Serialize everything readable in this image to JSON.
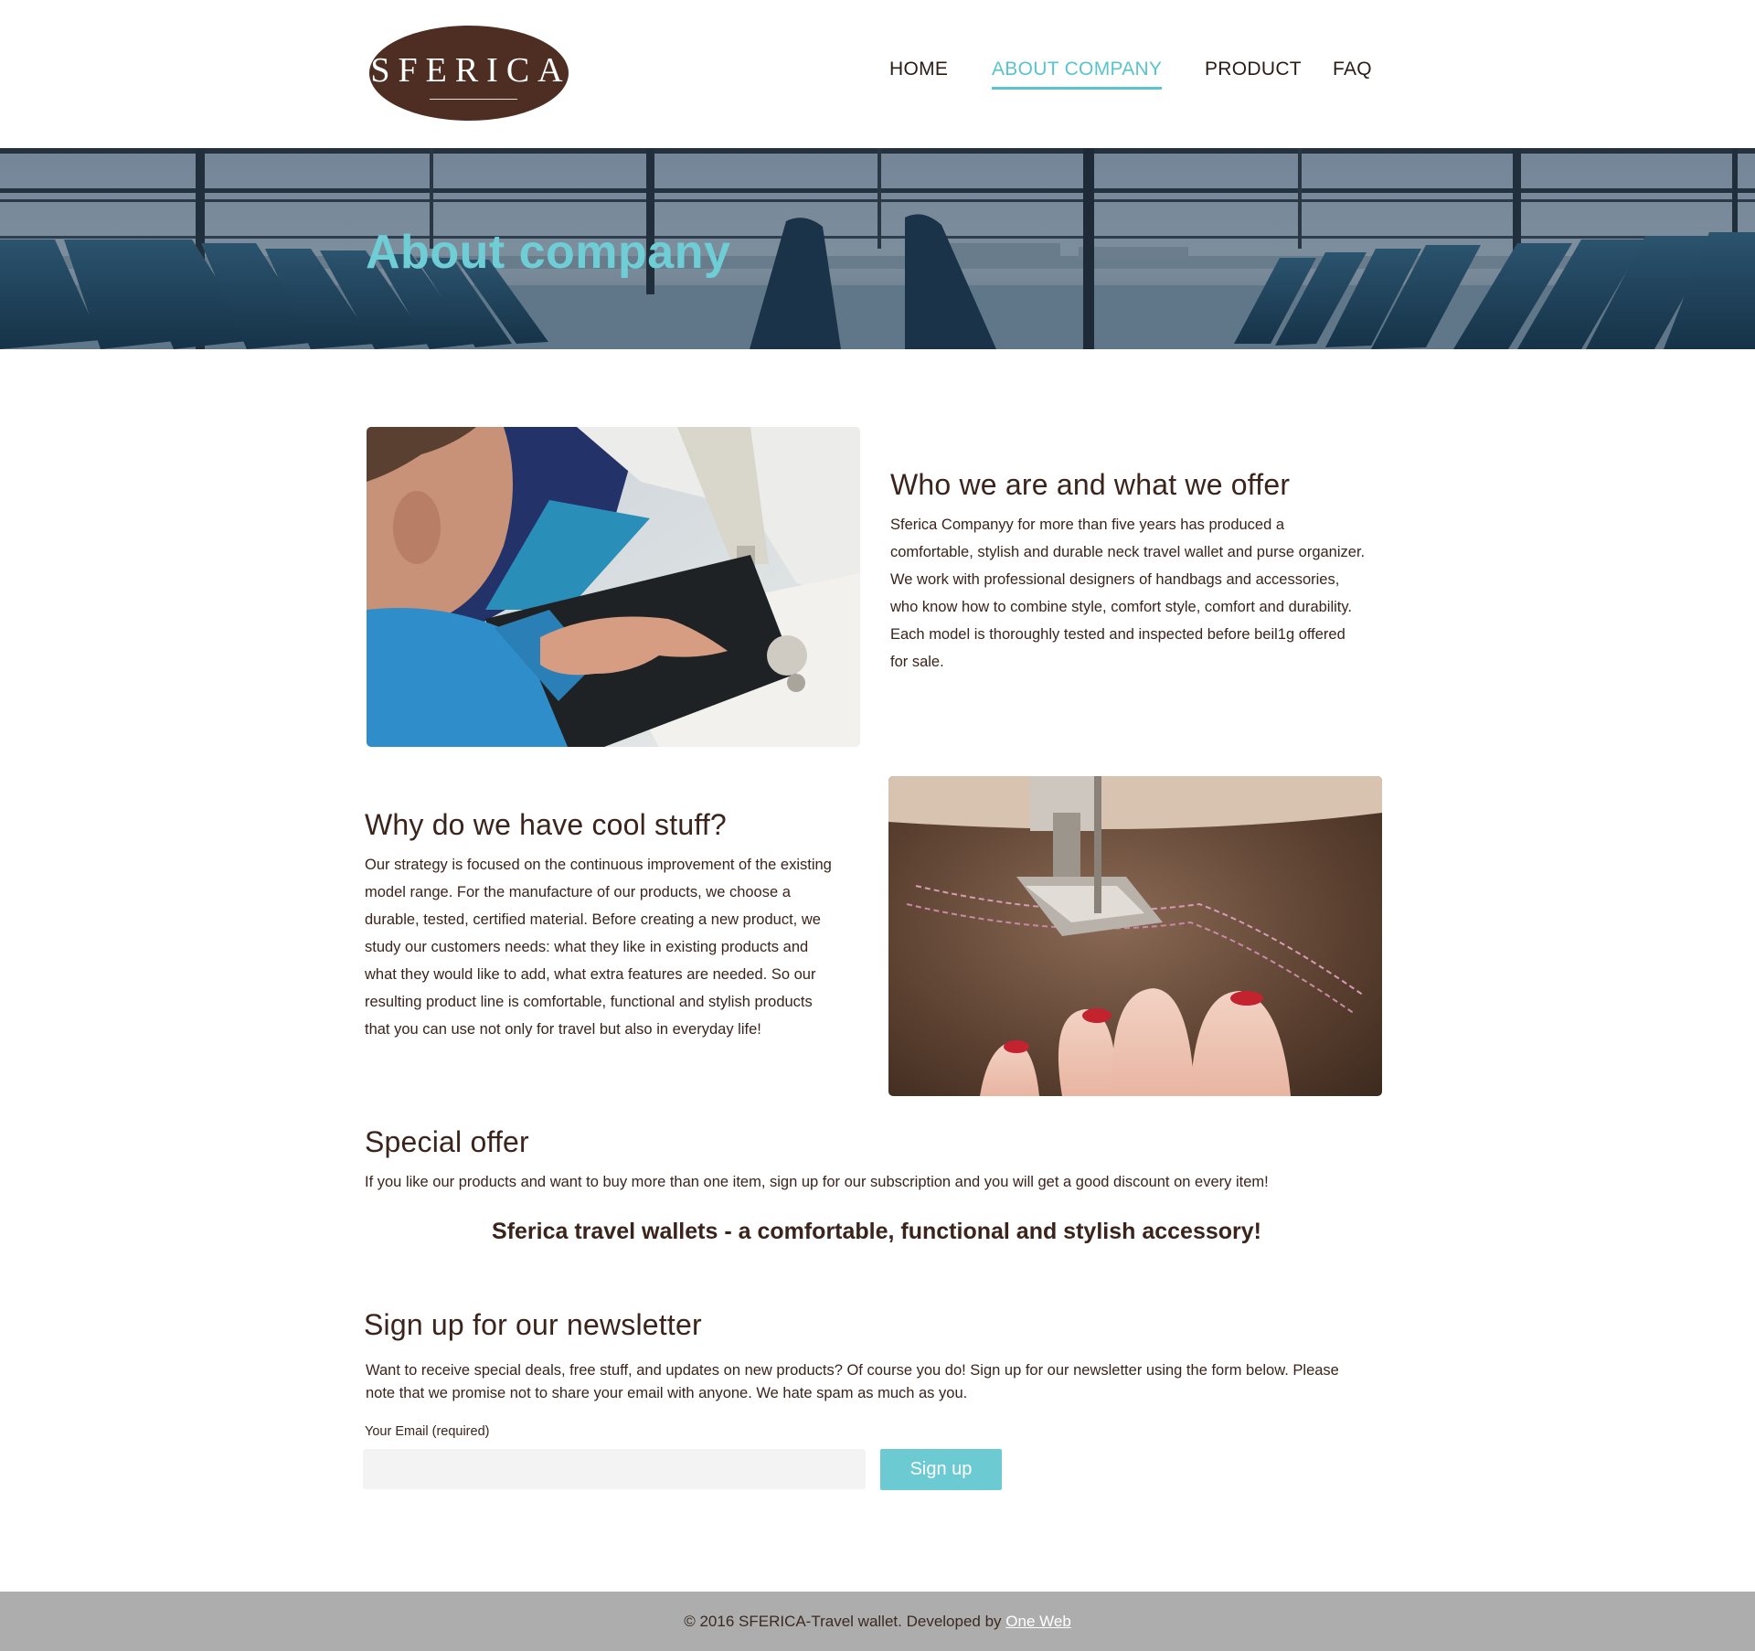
{
  "brand": {
    "logo_text": "SFERICA",
    "color": "#4e2d22"
  },
  "nav": {
    "items": [
      {
        "label": "HOME",
        "active": false
      },
      {
        "label": "ABOUT COMPANY",
        "active": true
      },
      {
        "label": "PRODUCT",
        "active": false
      },
      {
        "label": "FAQ",
        "active": false
      }
    ],
    "accent_color": "#5ac3cc"
  },
  "hero": {
    "title": "About company"
  },
  "sections": {
    "who": {
      "heading": "Who we are and what we offer",
      "body": "Sferica Companyy for more than five years has produced a comfortable, stylish and durable neck travel wallet and purse organizer. We work with professional designers of handbags and accessories, who know how to combine style, comfort style, comfort and durability. Each model is thoroughly tested and inspected before beil1g offered for sale."
    },
    "why": {
      "heading": "Why do we have cool stuff?",
      "body": "Our strategy is focused on the continuous improvement of the existing model range. For the manufacture of our products, we choose a durable, tested, certified material. Before creating a new product, we study our customers needs: what they like in existing products and what they would like to add, what extra features are needed. So our resulting product line is comfortable, functional and stylish products that you can use not only for travel but also in everyday life!"
    },
    "special": {
      "heading": "Special offer",
      "body": "If you like our products and want to buy more than one item, sign up for our subscription and you will get a good discount on every item!"
    },
    "tagline": "Sferica travel wallets - a comfortable, functional and stylish accessory!"
  },
  "newsletter": {
    "heading": "Sign up for our newsletter",
    "body": "Want to receive special deals, free stuff, and updates on new products? Of course you do! Sign up for our newsletter using the form below. Please note that we promise not to share your email with anyone. We hate spam as much as you.",
    "email_label": "Your Email (required)",
    "email_value": "",
    "button_label": "Sign up",
    "button_color": "#6ccbd2"
  },
  "footer": {
    "text": "© 2016 SFERICA-Travel wallet. Developed by ",
    "link_text": "One Web"
  },
  "icons": {
    "photo_1": "man-sewing-photo",
    "photo_2": "sewing-machine-leather-photo"
  }
}
